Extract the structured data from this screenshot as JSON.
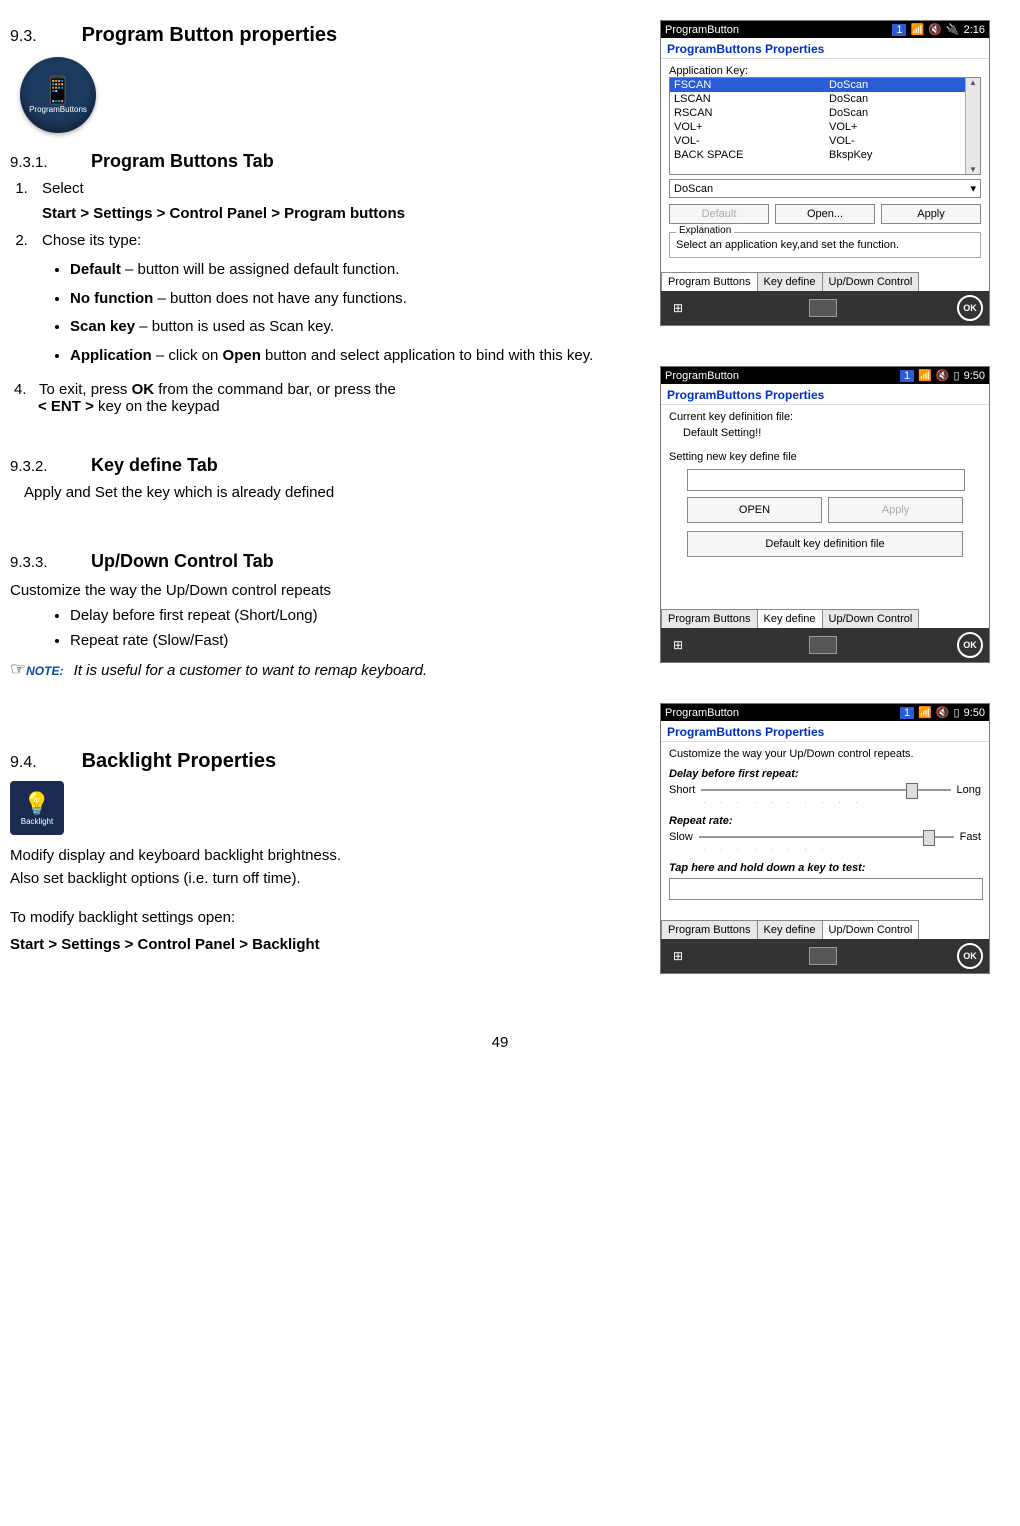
{
  "section_93": {
    "num": "9.3.",
    "title": "Program Button properties"
  },
  "icon_pb": {
    "label": "ProgramButtons"
  },
  "section_931": {
    "num": "9.3.1.",
    "title": "Program Buttons Tab"
  },
  "steps": {
    "s1": "Select",
    "path1": "Start > Settings > Control Panel > Program buttons",
    "s2": "Chose its type:",
    "b_default_l": "Default",
    "b_default_t": " – button will be assigned default function.",
    "b_nofunc_l": "No function",
    "b_nofunc_t": " – button does not have any functions.",
    "b_scan_l": "Scan key",
    "b_scan_t": " – button is used as Scan key.",
    "b_app_l": "Application",
    "b_app_t1": " – click on ",
    "b_app_open": "Open",
    "b_app_t2": " button and select application to bind with this key.",
    "s4a": "To exit, press ",
    "s4_ok": "OK",
    "s4b": " from the command bar, or press the",
    "s4c": "< ENT >",
    "s4d": " key on the keypad"
  },
  "section_932": {
    "num": "9.3.2.",
    "title": "Key define Tab"
  },
  "kd_text": "Apply and Set the key which is already defined",
  "section_933": {
    "num": "9.3.3.",
    "title": "Up/Down Control Tab"
  },
  "ud_intro": "Customize the way the Up/Down control repeats",
  "ud_b1": "Delay before first repeat (Short/Long)",
  "ud_b2": "Repeat rate (Slow/Fast)",
  "note": {
    "hand": "☞",
    "label": "NOTE:",
    "text": "It is useful for a customer to want to remap keyboard."
  },
  "section_94": {
    "num": "9.4.",
    "title": "Backlight Properties"
  },
  "icon_bl": {
    "label": "Backlight"
  },
  "bl_p1": "Modify display and keyboard backlight brightness.",
  "bl_p2": "Also set backlight options (i.e. turn off time).",
  "bl_p3": "To modify backlight settings open:",
  "bl_path": "Start > Settings > Control Panel > Backlight",
  "page_number": "49",
  "ss1": {
    "titlebar": {
      "app": "ProgramButton",
      "time": "2:16"
    },
    "header": "ProgramButtons Properties",
    "label_appkey": "Application Key:",
    "rows": [
      {
        "k": "FSCAN",
        "v": "DoScan",
        "sel": true
      },
      {
        "k": "LSCAN",
        "v": "DoScan"
      },
      {
        "k": "RSCAN",
        "v": "DoScan"
      },
      {
        "k": "VOL+",
        "v": "VOL+"
      },
      {
        "k": "VOL-",
        "v": "VOL-"
      },
      {
        "k": "BACK SPACE",
        "v": "BkspKey"
      }
    ],
    "combo": "DoScan",
    "btn_default": "Default",
    "btn_open": "Open...",
    "btn_apply": "Apply",
    "group_legend": "Explanation",
    "group_text": "Select an application key,and set the function.",
    "tabs": [
      "Program Buttons",
      "Key define",
      "Up/Down Control"
    ],
    "active_tab": 0,
    "ok": "OK"
  },
  "ss2": {
    "titlebar": {
      "app": "ProgramButton",
      "time": "9:50"
    },
    "header": "ProgramButtons Properties",
    "l1": "Current key definition file:",
    "l2": "Default Setting!!",
    "l3": "Setting new key define file",
    "btn_open": "OPEN",
    "btn_apply": "Apply",
    "btn_default": "Default key definition file",
    "tabs": [
      "Program Buttons",
      "Key define",
      "Up/Down Control"
    ],
    "active_tab": 1,
    "ok": "OK"
  },
  "ss3": {
    "titlebar": {
      "app": "ProgramButton",
      "time": "9:50"
    },
    "header": "ProgramButtons Properties",
    "intro": "Customize the way your Up/Down control repeats.",
    "sec1": "Delay before first repeat:",
    "s1_left": "Short",
    "s1_right": "Long",
    "sec2": "Repeat rate:",
    "s2_left": "Slow",
    "s2_right": "Fast",
    "sec3": "Tap here and hold down a key to test:",
    "tabs": [
      "Program Buttons",
      "Key define",
      "Up/Down Control"
    ],
    "active_tab": 2,
    "ok": "OK"
  }
}
